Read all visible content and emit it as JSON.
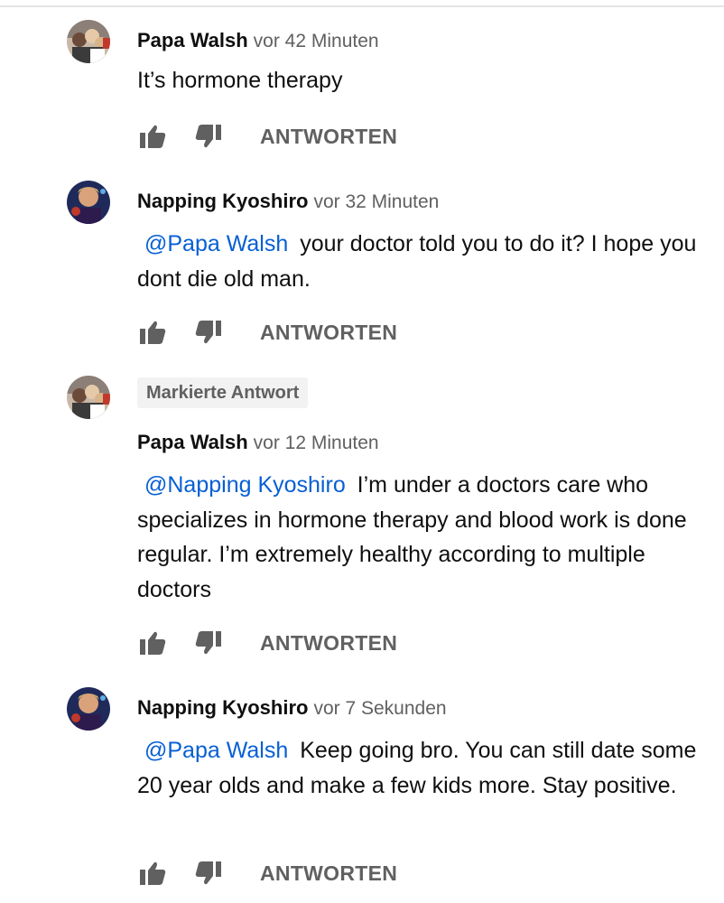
{
  "comments": [
    {
      "author": "Papa Walsh",
      "time": "vor 42 Minuten",
      "mention": "",
      "text": "It’s hormone therapy",
      "reply_label": "ANTWORTEN"
    },
    {
      "author": "Napping Kyoshiro",
      "time": "vor 32 Minuten",
      "mention": "@Papa Walsh",
      "text": "your doctor told you to do it? I hope you dont die old man.",
      "reply_label": "ANTWORTEN"
    },
    {
      "badge": "Markierte Antwort",
      "author": "Papa Walsh",
      "time": "vor 12 Minuten",
      "mention": "@Napping Kyoshiro",
      "text": "I’m under a doctors care who specializes in hormone therapy and blood work is done regular. I’m extremely healthy according to multiple doctors",
      "reply_label": "ANTWORTEN"
    },
    {
      "author": "Napping Kyoshiro",
      "time": "vor 7 Sekunden",
      "mention": "@Papa Walsh",
      "text": "Keep going bro. You can still date some 20 year olds and make a few kids more. Stay positive.",
      "reply_label": "ANTWORTEN"
    }
  ],
  "icons": {
    "like": "thumbs-up-icon",
    "dislike": "thumbs-down-icon"
  },
  "colors": {
    "mention": "#065fd4",
    "secondary_text": "#606060",
    "badge_bg": "#f2f2f2"
  }
}
